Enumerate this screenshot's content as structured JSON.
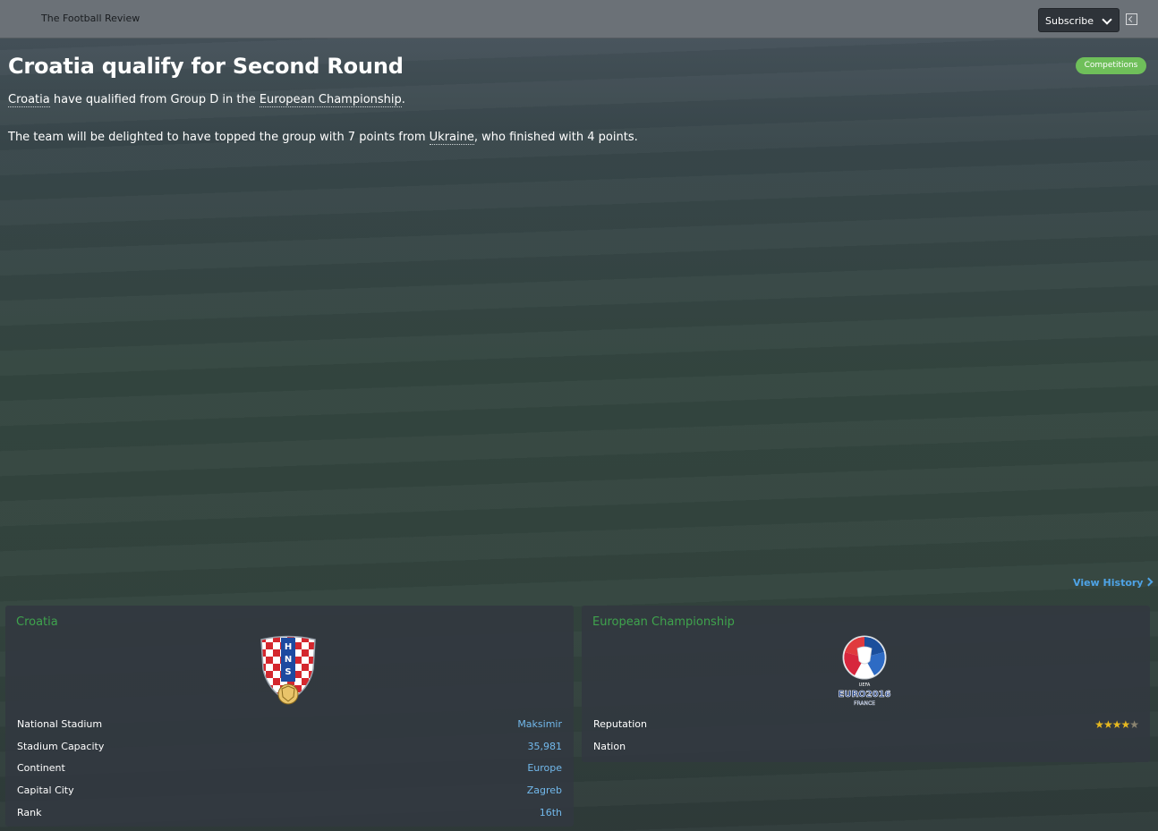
{
  "topbar": {
    "publication": "The Football Review",
    "subscribe_label": "Subscribe"
  },
  "article": {
    "headline": "Croatia qualify for Second Round",
    "tag": "Competitions",
    "para1": {
      "link1": "Croatia",
      "text1": " have qualified from Group D in the ",
      "link2": "European Championship",
      "text2": "."
    },
    "para2": {
      "text1": "The team will be delighted to have topped the group with 7 points from ",
      "link1": "Ukraine",
      "text2": ", who finished with 4 points."
    }
  },
  "view_history_label": "View History",
  "team_panel": {
    "title": "Croatia",
    "crest_letters": "HNS",
    "rows": [
      {
        "label": "National Stadium",
        "value": "Maksimir"
      },
      {
        "label": "Stadium Capacity",
        "value": "35,981"
      },
      {
        "label": "Continent",
        "value": "Europe"
      },
      {
        "label": "Capital City",
        "value": "Zagreb"
      },
      {
        "label": "Rank",
        "value": "16th"
      }
    ]
  },
  "competition_panel": {
    "title": "European Championship",
    "logo_text": "EURO2016",
    "logo_subtext": "FRANCE",
    "logo_top_text": "UEFA",
    "rows": [
      {
        "label": "Reputation",
        "stars": 4.5
      },
      {
        "label": "Nation",
        "value": ""
      }
    ]
  },
  "colors": {
    "accent_green": "#3fa34d",
    "link_blue": "#72b9ec",
    "tag_green": "#6fbf5a",
    "star_gold": "#e6b820"
  }
}
